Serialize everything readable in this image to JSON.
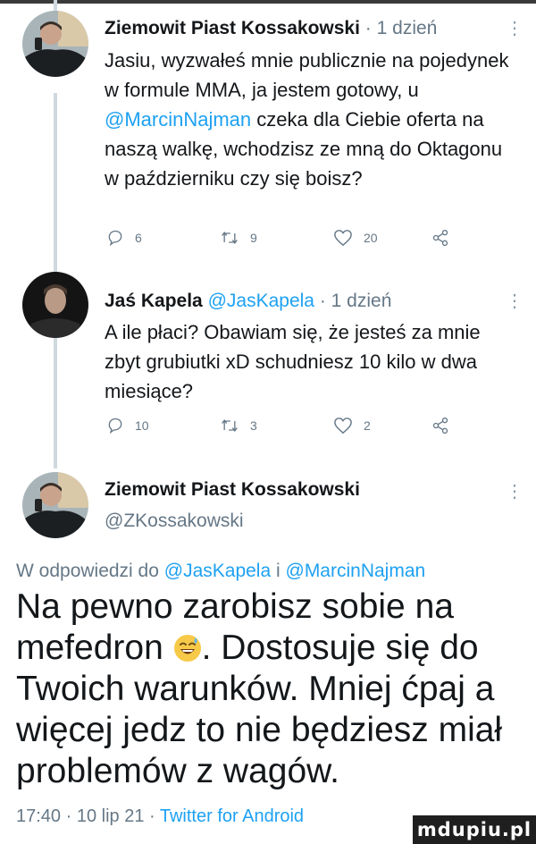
{
  "tweet1": {
    "author_name": "Ziemowit Piast Kossakowski",
    "separator": "·",
    "time": "1 dzień",
    "text_part1": "Jasiu, wyzwałeś mnie publicznie na pojedynek w formule MMA, ja jestem gotowy, u ",
    "mention": "@MarcinNajman",
    "text_part2": " czeka dla Ciebie oferta na naszą walkę, wchodzisz ze mną do Oktagonu w październiku czy się boisz?",
    "replies": "6",
    "retweets": "9",
    "likes": "20"
  },
  "tweet2": {
    "author_name": "Jaś Kapela",
    "author_handle": "@JasKapela",
    "separator": "·",
    "time": "1 dzień",
    "text": "A ile płaci? Obawiam się, że jesteś za mnie zbyt grubiutki xD schudniesz 10 kilo w dwa miesiące?",
    "replies": "10",
    "retweets": "3",
    "likes": "2"
  },
  "main_tweet": {
    "author_name": "Ziemowit Piast Kossakowski",
    "author_handle": "@ZKossakowski",
    "reply_prefix": "W odpowiedzi do ",
    "reply_mention1": "@JasKapela",
    "reply_conjunction": " i ",
    "reply_mention2": "@MarcinNajman",
    "text_part1": "Na pewno zarobisz sobie na mefedron ",
    "text_part2": ". Dostosuje się do Twoich warunków. Mniej ćpaj a więcej jedz to nie będziesz miał problemów z wagów.",
    "timestamp": "17:40 · 10 lip 21 · ",
    "client": "Twitter for Android"
  },
  "icons": {
    "more": "more-vertical-icon",
    "reply": "reply-icon",
    "retweet": "retweet-icon",
    "like": "heart-icon",
    "share": "share-icon",
    "emoji": "sweat-smile-emoji"
  },
  "more_glyph": "⋮",
  "watermark": "mdupiu.pl",
  "colors": {
    "text": "#14171a",
    "muted": "#657786",
    "link": "#1da1f2",
    "thread_line": "#cfd9de"
  }
}
